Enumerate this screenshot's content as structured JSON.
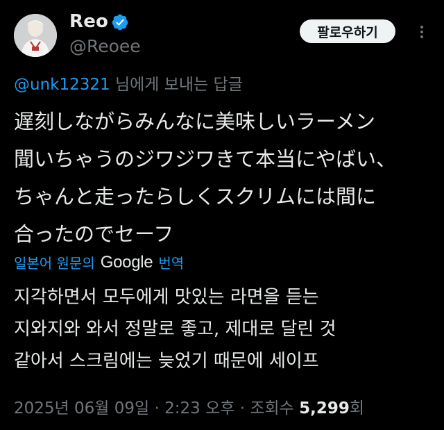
{
  "colors": {
    "background": "#000000",
    "text_primary": "#e7e9ea",
    "text_secondary": "#71767b",
    "accent": "#1d9bf0",
    "follow_button_bg": "#eff3f4"
  },
  "author": {
    "display_name": "Reo",
    "handle": "@Reoee",
    "verified_icon": "verified-badge-icon",
    "avatar": "avatar"
  },
  "header": {
    "follow_label": "팔로우하기",
    "more_icon": "more-horizontal-icon"
  },
  "reply": {
    "to_user": "@unk12321",
    "suffix": " 님에게 보내는 답글"
  },
  "tweet": {
    "lines": [
      "遅刻しながらみんなに美味しいラーメン",
      "聞いちゃうのジワジワきて本当にやばい、",
      "ちゃんと走ったらしくスクリムには間に",
      "合ったのでセーフ"
    ]
  },
  "translation": {
    "prefix": "일본어 원문의",
    "provider": "Google",
    "suffix": "번역",
    "lines": [
      "지각하면서 모두에게 맛있는 라면을 듣는",
      "지와지와 와서 정말로 좋고, 제대로 달린 것",
      "같아서 스크림에는 늦었기 때문에 세이프"
    ]
  },
  "meta": {
    "date": "2025년 06월 09일",
    "separator": " · ",
    "time": "2:23 오후",
    "views_label": "조회수",
    "views_count": "5,299",
    "views_suffix": "회"
  }
}
